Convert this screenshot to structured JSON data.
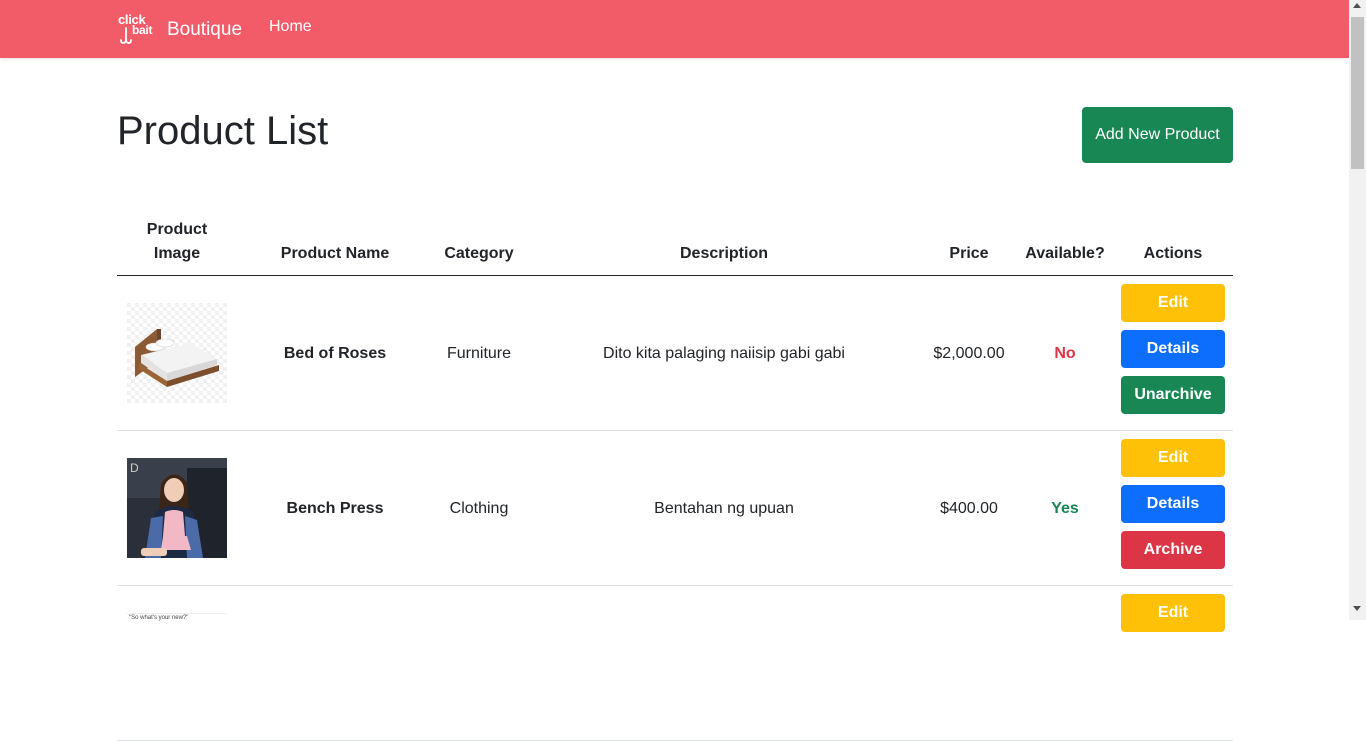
{
  "navbar": {
    "logo_top": "click",
    "logo_bottom": "bait",
    "brand": "Boutique",
    "home_label": "Home",
    "bg_color": "#f25c69"
  },
  "page": {
    "title": "Product List",
    "add_button_label": "Add New Product"
  },
  "table": {
    "headers": [
      "Product Image",
      "Product Name",
      "Category",
      "Description",
      "Price",
      "Available?",
      "Actions"
    ],
    "rows": [
      {
        "image_icon": "bed-image",
        "name": "Bed of Roses",
        "category": "Furniture",
        "description": "Dito kita palaging naiisip gabi gabi",
        "price": "$2,000.00",
        "available": "No",
        "actions": [
          "Edit",
          "Details",
          "Unarchive"
        ]
      },
      {
        "image_icon": "woman-portrait-image",
        "name": "Bench Press",
        "category": "Clothing",
        "description": "Bentahan ng upuan",
        "price": "$400.00",
        "available": "Yes",
        "actions": [
          "Edit",
          "Details",
          "Archive"
        ]
      },
      {
        "image_icon": "quote-image",
        "image_caption": "\"So what's your new?\"",
        "actions": [
          "Edit"
        ]
      }
    ]
  },
  "colors": {
    "success": "#198754",
    "primary": "#0d6efd",
    "warning": "#ffc107",
    "danger": "#dc3545"
  }
}
